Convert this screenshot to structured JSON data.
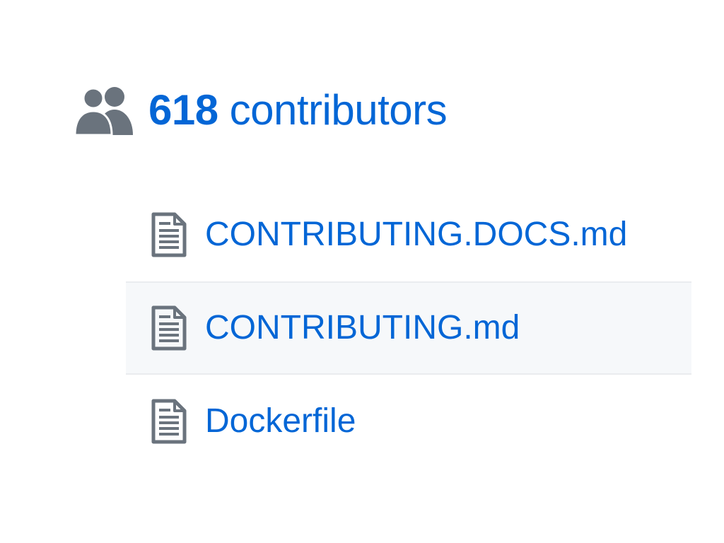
{
  "contributors": {
    "count": "618",
    "label": "contributors",
    "icon": "people-icon"
  },
  "files": [
    {
      "name": "CONTRIBUTING.DOCS.md",
      "icon": "file-text-icon",
      "highlighted": false
    },
    {
      "name": "CONTRIBUTING.md",
      "icon": "file-text-icon",
      "highlighted": true
    },
    {
      "name": "Dockerfile",
      "icon": "file-text-icon",
      "highlighted": false
    }
  ],
  "colors": {
    "link": "#0366d6",
    "icon": "#6a737d",
    "row_highlight": "#f6f8fa",
    "row_border": "#eaecef"
  }
}
